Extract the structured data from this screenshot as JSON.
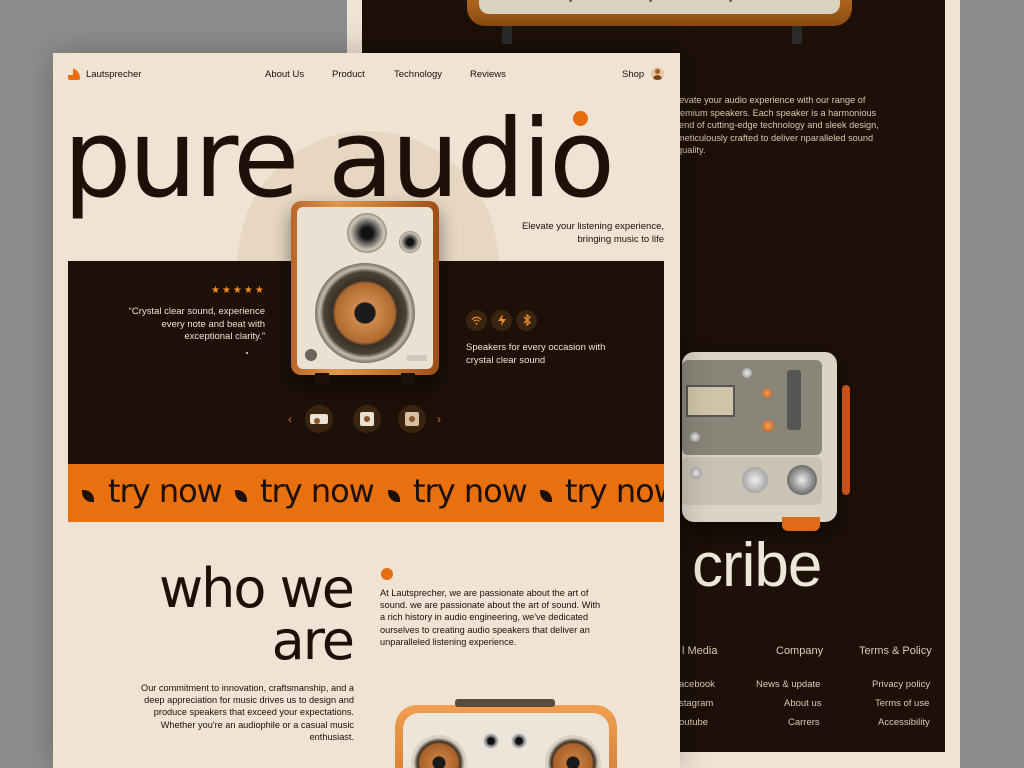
{
  "brand": {
    "name": "Lautsprecher",
    "accent": "#e86c10",
    "dark": "#1c1008",
    "cream": "#efe3d3"
  },
  "nav": {
    "items": [
      "About Us",
      "Product",
      "Technology",
      "Reviews"
    ],
    "shop": "Shop"
  },
  "hero": {
    "title": "pure audio",
    "subtitle": "Elevate your listening experience, bringing music to life",
    "rating_stars": "★★★★★",
    "quote": "“Crystal clear sound, experience every note and beat with exceptional clarity.”",
    "feature_icons": [
      "wifi-icon",
      "lightning-icon",
      "bluetooth-icon"
    ],
    "feature_text": "Speakers for every occasion with crystal clear sound",
    "carousel_prev": "‹",
    "carousel_next": "›"
  },
  "try_band": {
    "label": "try now"
  },
  "who": {
    "title_line1": "who we",
    "title_line2": "are",
    "text": "At Lautsprecher, we are passionate about the art of sound. we are passionate about the art of sound. With a rich history in audio engineering, we've dedicated ourselves to creating audio speakers that deliver an unparalleled listening experience.",
    "commitment": "Our commitment to innovation, craftsmanship, and a deep appreciation for music drives us to design and produce speakers that exceed your expectations. Whether you're an audiophile or a casual music enthusiast."
  },
  "back_page": {
    "intro": "levate your audio experience with our range of remium speakers. Each speaker is a harmonious lend of cutting-edge technology and sleek design, meticulously crafted to deliver nparalleled sound quality.",
    "big_word": "cribe",
    "footer": {
      "social_head": "l Media",
      "social_links": [
        "acebook",
        "stagram",
        "outube"
      ],
      "company_head": "Company",
      "company_links": [
        "News & update",
        "About us",
        "Carrers"
      ],
      "terms_head": "Terms & Policy",
      "terms_links": [
        "Privacy policy",
        "Terms of use",
        "Accessibility"
      ]
    }
  }
}
